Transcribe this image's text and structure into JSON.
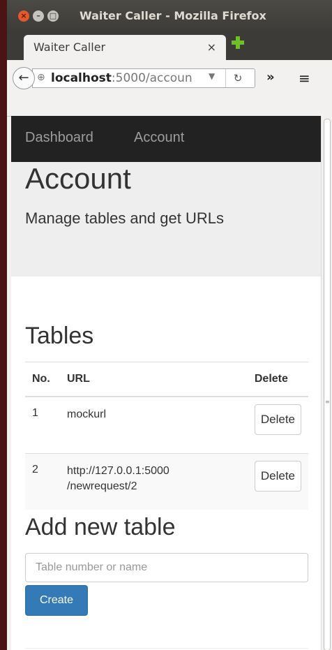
{
  "window": {
    "title": "Waiter Caller - Mozilla Firefox"
  },
  "browser": {
    "tab_title": "Waiter Caller",
    "tab_close": "×",
    "url_host": "localhost",
    "url_rest": ":5000/accoun",
    "overflow_icon": "»",
    "menu_icon": "≡"
  },
  "nav": {
    "dashboard": "Dashboard",
    "account": "Account"
  },
  "jumbotron": {
    "title": "Account",
    "subtitle": "Manage tables and get URLs"
  },
  "tables_section": {
    "heading": "Tables",
    "columns": [
      "No.",
      "URL",
      "Delete"
    ],
    "rows": [
      {
        "no": "1",
        "url_line1": "mockurl",
        "url_line2": "",
        "delete_label": "Delete"
      },
      {
        "no": "2",
        "url_line1": "http://127.0.0.1:5000",
        "url_line2": "/newrequest/2",
        "delete_label": "Delete"
      }
    ]
  },
  "add_section": {
    "heading": "Add new table",
    "input_placeholder": "Table number or name",
    "create_label": "Create"
  },
  "colors": {
    "navbar": "#222222",
    "primary": "#337ab7",
    "jumbotron": "#eeeeee"
  }
}
